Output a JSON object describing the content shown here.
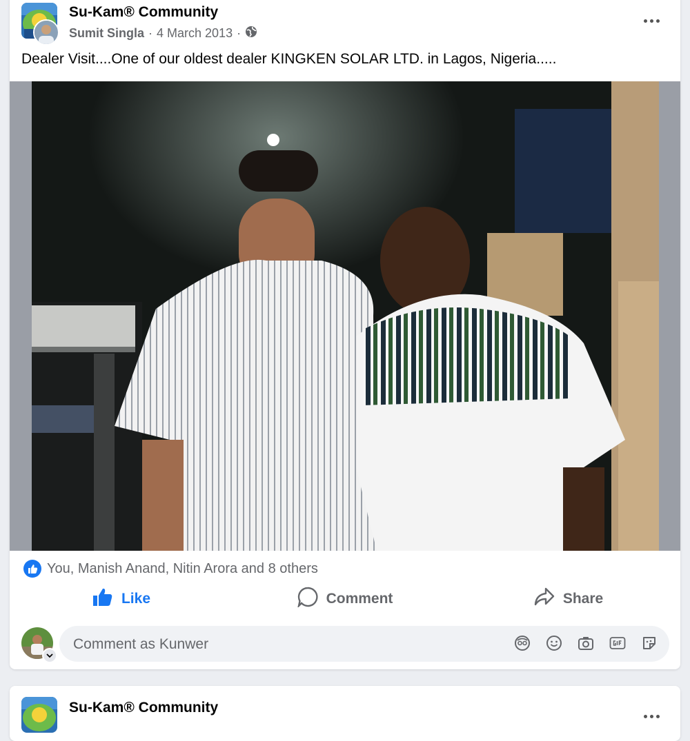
{
  "post": {
    "group_name": "Su-Kam® Community",
    "author": "Sumit Singla",
    "date": "4 March 2013",
    "separator": "·",
    "privacy_icon": "globe-icon",
    "text": "Dealer Visit....One of our oldest dealer KINGKEN SOLAR LTD. in Lagos, Nigeria.....",
    "reactions_text": "You, Manish Anand, Nitin Arora and 8 others",
    "actions": {
      "like": "Like",
      "comment": "Comment",
      "share": "Share"
    },
    "comment_placeholder": "Comment as Kunwer",
    "comment_tools": [
      "avatar-sticker-icon",
      "emoji-icon",
      "camera-icon",
      "gif-icon",
      "sticker-icon"
    ]
  },
  "next_post": {
    "group_name": "Su-Kam® Community"
  },
  "colors": {
    "brand_blue": "#1877f2",
    "secondary_text": "#65676b",
    "background": "#eceef2"
  }
}
